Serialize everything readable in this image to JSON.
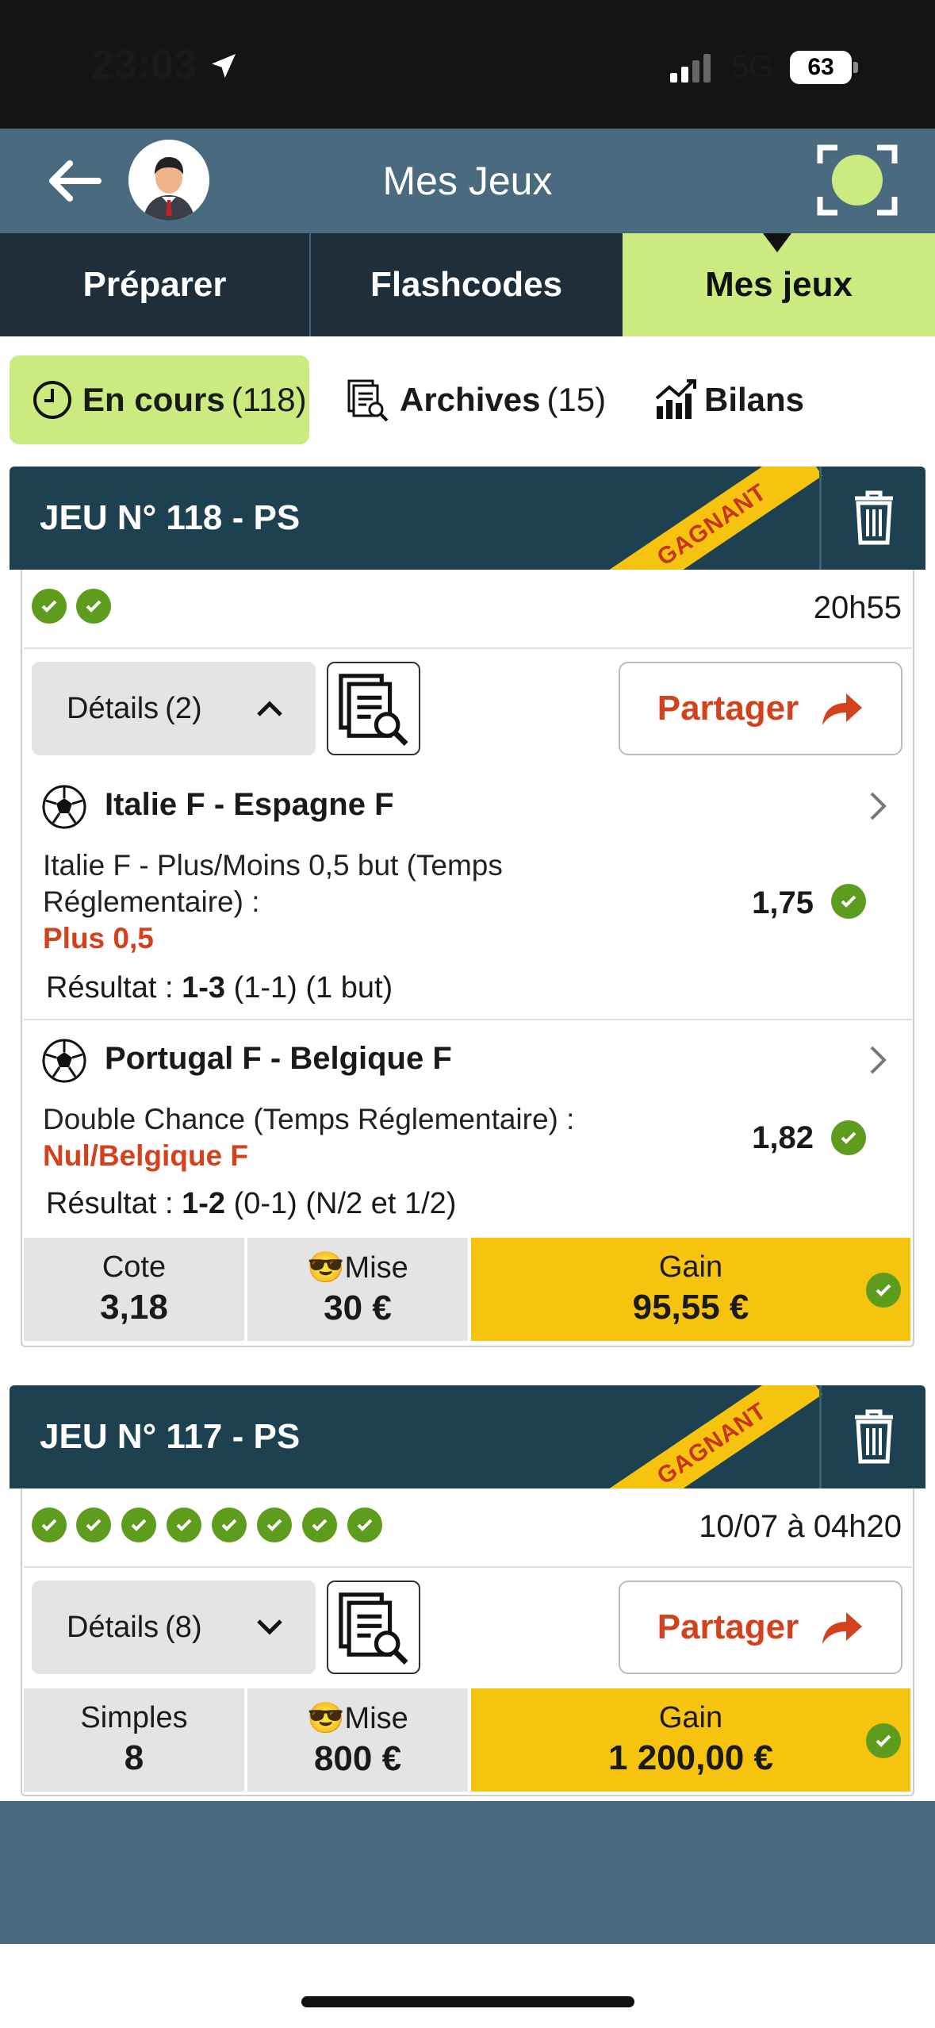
{
  "status": {
    "time": "23:03",
    "network": "5G",
    "battery": "63"
  },
  "header": {
    "title": "Mes Jeux"
  },
  "tabs": [
    {
      "label": "Préparer"
    },
    {
      "label": "Flashcodes"
    },
    {
      "label": "Mes jeux"
    }
  ],
  "subtabs": [
    {
      "label": "En cours",
      "count": "(118)"
    },
    {
      "label": "Archives",
      "count": "(15)"
    },
    {
      "label": "Bilans"
    }
  ],
  "cards": [
    {
      "title": "JEU N° 118 - PS",
      "banner": "GAGNANT",
      "time": "20h55",
      "details_label": "Détails",
      "details_count": "(2)",
      "share_label": "Partager",
      "bets": [
        {
          "match": "Italie F - Espagne F",
          "market_line1": "Italie F - Plus/Moins 0,5 but (Temps",
          "market_line2": "Réglementaire) :",
          "pick": "Plus 0,5",
          "odd": "1,75",
          "result_label": "Résultat :",
          "result_score": "1-3",
          "result_detail": "(1-1) (1 but)"
        },
        {
          "match": "Portugal F - Belgique F",
          "market_line1": "Double Chance (Temps Réglementaire) :",
          "pick": "Nul/Belgique F",
          "odd": "1,82",
          "result_label": "Résultat :",
          "result_score": "1-2",
          "result_detail": "(0-1) (N/2 et 1/2)"
        }
      ],
      "footer": {
        "left_label": "Cote",
        "left_value": "3,18",
        "mise_emoji": "😎",
        "mise_label": "Mise",
        "mise_value": "30 €",
        "gain_label": "Gain",
        "gain_value": "95,55 €"
      }
    },
    {
      "title": "JEU N° 117 - PS",
      "banner": "GAGNANT",
      "time": "10/07 à 04h20",
      "details_label": "Détails",
      "details_count": "(8)",
      "share_label": "Partager",
      "footer": {
        "left_label": "Simples",
        "left_value": "8",
        "mise_emoji": "😎",
        "mise_label": "Mise",
        "mise_value": "800 €",
        "gain_label": "Gain",
        "gain_value": "1 200,00 €"
      }
    }
  ],
  "colors": {
    "accent_green": "#cbeb80",
    "header_blue": "#4a6b7f",
    "dark_navy": "#1e2f3b",
    "gain_yellow": "#f6c40e",
    "share_orange": "#d3421c",
    "check_green": "#5e9c1e"
  }
}
